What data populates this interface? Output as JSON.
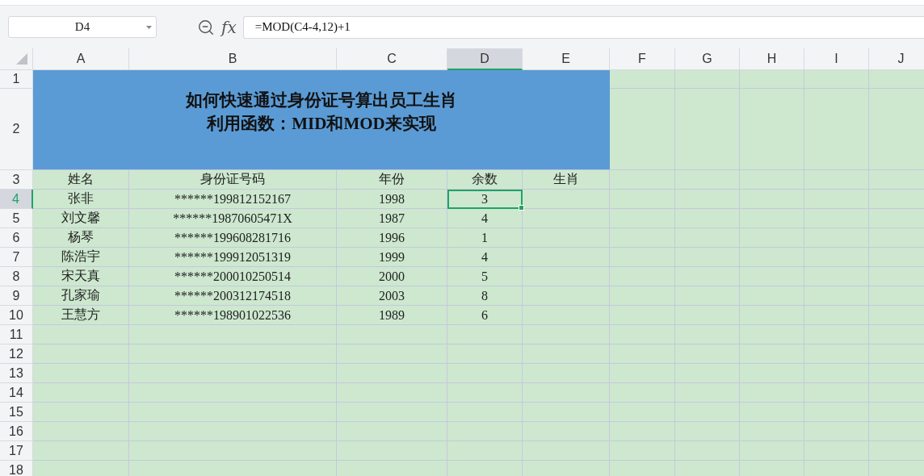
{
  "name_box": {
    "value": "D4"
  },
  "formula_bar": {
    "fx_label": "fx",
    "formula": "=MOD(C4-4,12)+1"
  },
  "columns": [
    {
      "label": "A",
      "selected": false
    },
    {
      "label": "B",
      "selected": false
    },
    {
      "label": "C",
      "selected": false
    },
    {
      "label": "D",
      "selected": true
    },
    {
      "label": "E",
      "selected": false
    },
    {
      "label": "F",
      "selected": false
    },
    {
      "label": "G",
      "selected": false
    },
    {
      "label": "H",
      "selected": false
    },
    {
      "label": "I",
      "selected": false
    },
    {
      "label": "J",
      "selected": false
    }
  ],
  "row_headers": [
    {
      "label": "1",
      "selected": false
    },
    {
      "label": "2",
      "selected": false
    },
    {
      "label": "3",
      "selected": false
    },
    {
      "label": "4",
      "selected": true
    },
    {
      "label": "5",
      "selected": false
    },
    {
      "label": "6",
      "selected": false
    },
    {
      "label": "7",
      "selected": false
    },
    {
      "label": "8",
      "selected": false
    },
    {
      "label": "9",
      "selected": false
    },
    {
      "label": "10",
      "selected": false
    },
    {
      "label": "11",
      "selected": false
    },
    {
      "label": "12",
      "selected": false
    },
    {
      "label": "13",
      "selected": false
    },
    {
      "label": "14",
      "selected": false
    },
    {
      "label": "15",
      "selected": false
    },
    {
      "label": "16",
      "selected": false
    },
    {
      "label": "17",
      "selected": false
    },
    {
      "label": "18",
      "selected": false
    }
  ],
  "title": {
    "lines": [
      "如何快速通过身份证号算出员工生肖",
      "利用函数：MID和MOD来实现"
    ]
  },
  "table_header": [
    "姓名",
    "身份证号码",
    "年份",
    "余数",
    "生肖"
  ],
  "rows": [
    {
      "cells": [
        {
          "text": "张非",
          "selected": false
        },
        {
          "text": "******199812152167",
          "selected": false
        },
        {
          "text": "1998",
          "selected": false
        },
        {
          "text": "3",
          "selected": true
        }
      ]
    },
    {
      "cells": [
        {
          "text": "刘文馨",
          "selected": false
        },
        {
          "text": "******19870605471X",
          "selected": false
        },
        {
          "text": "1987",
          "selected": false
        },
        {
          "text": "4",
          "selected": false
        }
      ]
    },
    {
      "cells": [
        {
          "text": "杨琴",
          "selected": false
        },
        {
          "text": "******199608281716",
          "selected": false
        },
        {
          "text": "1996",
          "selected": false
        },
        {
          "text": "1",
          "selected": false
        }
      ]
    },
    {
      "cells": [
        {
          "text": "陈浩宇",
          "selected": false
        },
        {
          "text": "******199912051319",
          "selected": false
        },
        {
          "text": "1999",
          "selected": false
        },
        {
          "text": "4",
          "selected": false
        }
      ]
    },
    {
      "cells": [
        {
          "text": "宋天真",
          "selected": false
        },
        {
          "text": "******200010250514",
          "selected": false
        },
        {
          "text": "2000",
          "selected": false
        },
        {
          "text": "5",
          "selected": false
        }
      ]
    },
    {
      "cells": [
        {
          "text": "孔家瑜",
          "selected": false
        },
        {
          "text": "******200312174518",
          "selected": false
        },
        {
          "text": "2003",
          "selected": false
        },
        {
          "text": "8",
          "selected": false
        }
      ]
    },
    {
      "cells": [
        {
          "text": "王慧方",
          "selected": false
        },
        {
          "text": "******198901022536",
          "selected": false
        },
        {
          "text": "1989",
          "selected": false
        },
        {
          "text": "6",
          "selected": false
        }
      ]
    }
  ]
}
